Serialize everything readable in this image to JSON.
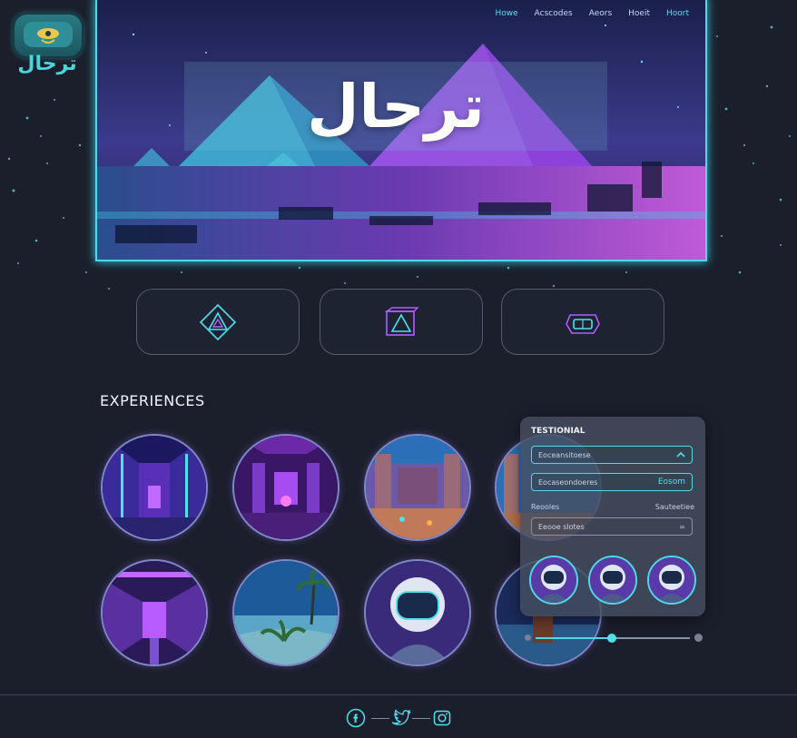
{
  "brand": {
    "logo_text": "ترحال"
  },
  "nav": {
    "items": [
      "Howe",
      "Acscodes",
      "Aeors",
      "Hoeit",
      "Hoort"
    ],
    "active_index": 0
  },
  "hero": {
    "title": "ترحال"
  },
  "features": [
    {
      "icon": "pyramid-diamond-icon"
    },
    {
      "icon": "pyramid-cube-icon"
    },
    {
      "icon": "vr-headset-icon"
    }
  ],
  "experiences": {
    "title": "EXPERIENCES",
    "items": [
      {
        "icon": "purple-temple-interior"
      },
      {
        "icon": "neon-throne-hall"
      },
      {
        "icon": "egyptian-temple-gate"
      },
      {
        "icon": "temple-columns"
      },
      {
        "icon": "neon-corridor"
      },
      {
        "icon": "desert-oasis"
      },
      {
        "icon": "astronaut-portrait"
      },
      {
        "icon": "dock-at-night"
      }
    ]
  },
  "testimonial_panel": {
    "title": "TESTIONIAL",
    "dropdown_value": "Eoceansitoese",
    "input_value": "Eocaseondoeres",
    "input_action": "Eosom",
    "label_left": "Reooles",
    "label_right": "Sauteetiee",
    "select_value": "Eeooe slotes",
    "select_icon": "=",
    "avatars": [
      "astronaut-avatar",
      "astronaut-avatar",
      "astronaut-avatar"
    ],
    "slider_value": 0.5
  },
  "footer": {
    "social": [
      "facebook-icon",
      "twitter-icon",
      "instagram-icon"
    ]
  },
  "colors": {
    "accent": "#4fd8e6",
    "background": "#1b1f2c",
    "purple": "#b45cff"
  }
}
